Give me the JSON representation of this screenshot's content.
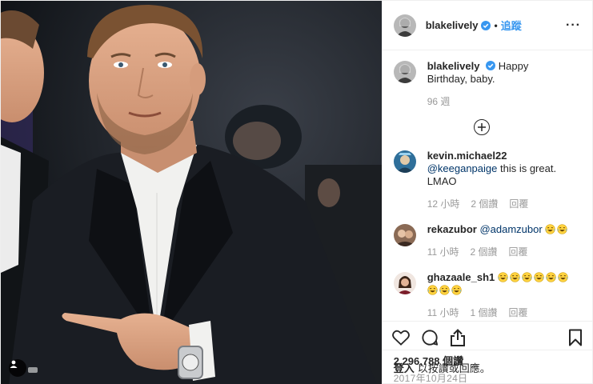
{
  "header": {
    "username": "blakelively",
    "separator": "•",
    "follow_label": "追蹤",
    "more_label": "···"
  },
  "caption": {
    "username": "blakelively",
    "text": "Happy Birthday, baby.",
    "time": "96 週"
  },
  "comments": [
    {
      "username": "kevin.michael22",
      "mention": "@keeganpaige",
      "text": "this is great. LMAO",
      "time": "12 小時",
      "likes": "2 個讚",
      "reply_label": "回覆"
    },
    {
      "username": "rekazubor",
      "mention": "@adamzubor",
      "text": "",
      "emoji_count": 2,
      "time": "11 小時",
      "likes": "2 個讚",
      "reply_label": "回覆"
    },
    {
      "username": "ghazaale_sh1",
      "mention": "",
      "text": "",
      "emoji_count": 9,
      "time": "11 小時",
      "likes": "1 個讚",
      "reply_label": "回覆"
    }
  ],
  "likes_count": "2,296,788 個讚",
  "post_date": "2017年10月24日",
  "login_bar": {
    "link": "登入",
    "text": "以按讚或回應。"
  },
  "colors": {
    "link_blue": "#3897f0",
    "mention_blue": "#003569",
    "muted_gray": "#999999",
    "verified_blue": "#3897f0"
  },
  "icons": [
    "heart-icon",
    "comment-icon",
    "share-icon",
    "bookmark-icon",
    "verified-badge-icon",
    "plus-circle-icon",
    "user-tag-icon"
  ]
}
